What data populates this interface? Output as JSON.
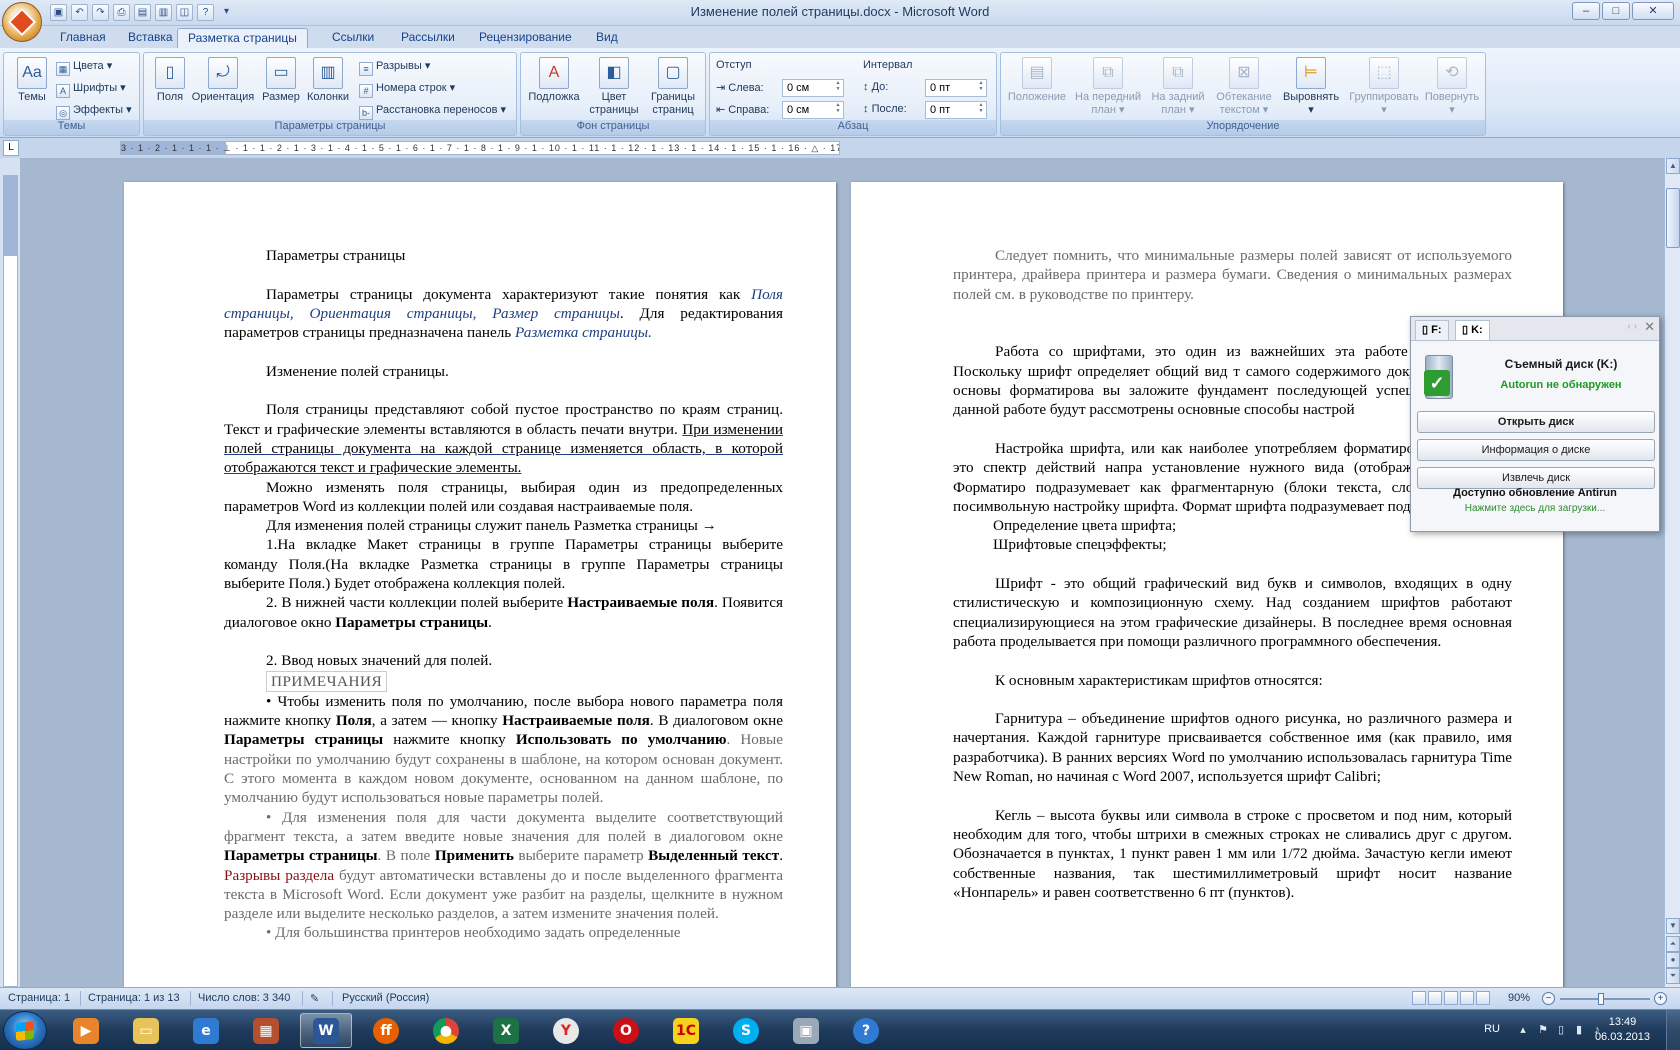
{
  "window": {
    "title": "Изменение полей страницы.docx - Microsoft Word",
    "controls": [
      "–",
      "□",
      "✕"
    ]
  },
  "qat": [
    "save",
    "undo",
    "redo",
    "print",
    "open",
    "quick-print",
    "preview",
    "help"
  ],
  "tabs": [
    "Главная",
    "Вставка",
    "Разметка страницы",
    "Ссылки",
    "Рассылки",
    "Рецензирование",
    "Вид"
  ],
  "active_tab": "Разметка страницы",
  "ribbon": {
    "themes": {
      "label": "Темы",
      "themes_btn": "Темы",
      "colors": "Цвета",
      "fonts": "Шрифты",
      "effects": "Эффекты"
    },
    "page_setup": {
      "label": "Параметры страницы",
      "margins": "Поля",
      "orientation": "Ориентация",
      "size": "Размер",
      "columns": "Колонки",
      "breaks": "Разрывы",
      "line_numbers": "Номера строк",
      "hyphenation": "Расстановка переносов"
    },
    "page_background": {
      "label": "Фон страницы",
      "watermark": "Подложка",
      "page_color_1": "Цвет",
      "page_color_2": "страницы",
      "borders_1": "Границы",
      "borders_2": "страниц"
    },
    "paragraph": {
      "label": "Абзац",
      "indent_title": "Отступ",
      "left_label": "Слева:",
      "left_value": "0 см",
      "right_label": "Справа:",
      "right_value": "0 см",
      "spacing_title": "Интервал",
      "before_label": "До:",
      "before_value": "0 пт",
      "after_label": "После:",
      "after_value": "0 пт"
    },
    "arrange": {
      "label": "Упорядочение",
      "position": "Положение",
      "front_1": "На передний",
      "front_2": "план",
      "back_1": "На задний",
      "back_2": "план",
      "wrap_1": "Обтекание",
      "wrap_2": "текстом",
      "align": "Выровнять",
      "group": "Группировать",
      "rotate": "Повернуть"
    }
  },
  "ruler": {
    "marks": "3 · 1 · 2 · 1 · 1 · 1 · ⊥ · 1 · 1 · 2 · 1 · 3 · 1 · 4 · 1 · 5 · 1 · 6 · 1 · 7 · 1 · 8 · 1 · 9 · 1 · 10 · 1 · 11 · 1 · 12 · 1 · 13 · 1 · 14 · 1 · 15 · 1 · 16 · △ · 17 ·"
  },
  "page1": {
    "p1": "Параметры страницы",
    "p2_a": "Параметры страницы документа характеризуют такие понятия как ",
    "p2_b": "Поля страницы, Ориентация страницы, Размер страницы",
    "p2_c": ". Для редактирования параметров страницы предназначена панель ",
    "p2_d": "Разметка страницы.",
    "p3": "Изменение полей страницы.",
    "p4_a": "Поля страницы представляют собой пустое пространство по краям страниц. Текст и графические элементы вставляются в область печати внутри. ",
    "p4_b": "При изменении полей страницы документа на каждой странице изменяется область, в которой отображаются текст и графические элементы.",
    "p5": "Можно изменять поля страницы, выбирая один из предопределенных параметров Word из коллекции полей или создавая настраиваемые поля.",
    "p6": "Для изменения полей страницы служит панель Разметка страницы →",
    "p7": "1.На вкладке Макет страницы в группе Параметры страницы выберите команду Поля.(На вкладке Разметка страницы в группе Параметры страницы выберите Поля.) Будет отображена коллекция полей.",
    "p8_a": "2.        В нижней части коллекции полей выберите ",
    "p8_b": "Настраиваемые поля",
    "p8_c": ". Появится диалоговое окно ",
    "p8_d": "Параметры страницы",
    "p8_e": ".",
    "p9": "2.        Ввод новых значений для полей.",
    "p10": "ПРИМЕЧАНИЯ",
    "p11_a": "•        Чтобы изменить поля по умолчанию, после выбора нового параметра поля нажмите кнопку ",
    "p11_b": "Поля",
    "p11_c": ", а затем — кнопку ",
    "p11_d": "Настраиваемые поля",
    "p11_e": ". В диалоговом окне ",
    "p11_f": "Параметры страницы",
    "p11_g": " нажмите кнопку ",
    "p11_h": "Использовать по умолчанию",
    "p11_i": ". Новые настройки по умолчанию будут сохранены в шаблоне, на котором основан документ. С этого момента в каждом новом документе, основанном на данном шаблоне, по умолчанию будут использоваться новые параметры полей.",
    "p12_a": "•        Для изменения поля для части документа выделите соответствующий фрагмент текста, а затем введите новые значения для полей в диалоговом окне ",
    "p12_b": "Параметры страницы",
    "p12_c": ". В поле ",
    "p12_d": "Применить",
    "p12_e": " выберите параметр ",
    "p12_f": "Выделенный текст",
    "p12_g": ". ",
    "p12_h": "Разрывы раздела",
    "p12_i": " будут автоматически вставлены до и после выделенного фрагмента текста в Microsoft Word. Если документ уже разбит на разделы, щелкните в нужном разделе или выделите несколько разделов, а затем измените значения полей.",
    "p13": "•        Для большинства принтеров необходимо задать определенные"
  },
  "page2": {
    "p1": "Следует помнить, что минимальные размеры полей зависят от используемого принтера, драйвера принтера и размера бумаги. Сведения о минимальных размерах полей см. в руководстве по принтеру.",
    "p2": "Работа со шрифтами, это один из важнейших эта работе в Word 2010. Поскольку шрифт определяет общий вид т самого содержимого документа. Освоив основы форматирова вы заложите фундамент последующей успешной работы в данной работе будут рассмотрены основные способы настрой",
    "p3": "Настройка шрифта, или как наиболее употребляем форматирование шрифта, это спектр действий напра установление нужного вида (отображения) шрифта. Форматиро подразумевает как фрагментарную (блоки текста, слова, с ) так и посимвольную настройку шрифта. Формат шрифта подразумевает под собой:",
    "p4": "Определение цвета шрифта;",
    "p5": "Шрифтовые спецэффекты;",
    "p6": "Шрифт - это общий графический вид букв и символов, входящих в одну стилистическую и композиционную схему. Над созданием шрифтов работают специализирующиеся на этом графические дизайнеры. В последнее время основная работа проделывается при помощи различного программного обеспечения.",
    "p7": "К основным характеристикам шрифтов относятся:",
    "p8": "Гарнитура – объединение шрифтов одного рисунка, но различного размера и начертания. Каждой гарнитуре присваивается собственное имя (как правило, имя разработчика). В ранних версиях Word по умолчанию использовалась гарнитура Time New Roman, но начиная с Word 2007, используется шрифт Calibri;",
    "p9": "Кегль – высота буквы или символа в строке с просветом и под ним, который необходим для того, чтобы штрихи в смежных строках не сливались друг с другом. Обозначается в пунктах, 1 пункт равен 1 мм или 1/72 дюйма. Зачастую кегли имеют собственные названия, так шестимиллиметровый шрифт носит название «Нонпарель» и равен соответственно 6 пт (пунктов)."
  },
  "status": {
    "page": "Страница: 1",
    "page_of": "Страница: 1 из 13",
    "words": "Число слов: 3 340",
    "lang": "Русский (Россия)",
    "zoom": "90%"
  },
  "popup": {
    "tab_f": "F:",
    "tab_k": "K:",
    "title": "Съемный диск  (K:)",
    "status": "Autorun не обнаружен",
    "open": "Открыть диск",
    "info": "Информация о диске",
    "eject": "Извлечь диск",
    "update": "Доступно обновление Antirun",
    "update_link": "Нажмите здесь для загрузки..."
  },
  "taskbar": {
    "apps": [
      "windows-media-player",
      "explorer",
      "internet-explorer",
      "archiver",
      "word",
      "firefox",
      "chrome",
      "excel",
      "yandex-browser",
      "opera",
      "1c",
      "skype",
      "app-generic",
      "help"
    ],
    "lang": "RU",
    "time": "13:49",
    "date": "06.03.2013"
  },
  "colors": {
    "ribbon": "#dbe7f7",
    "accent": "#15428b",
    "hyperlink": "#1f3e82",
    "ok_green": "#1f9b24"
  }
}
